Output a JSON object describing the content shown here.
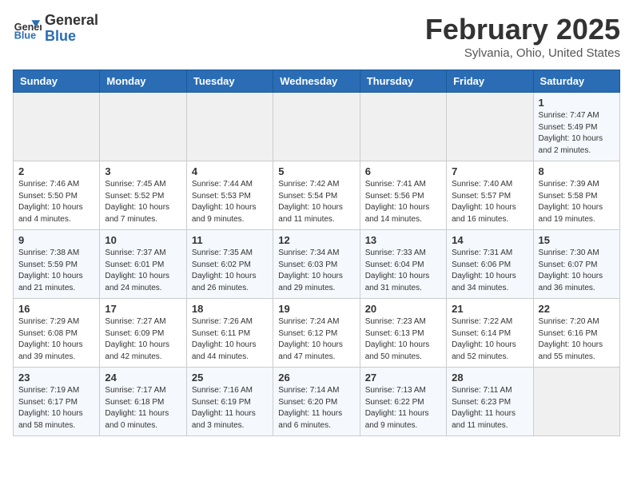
{
  "header": {
    "logo_general": "General",
    "logo_blue": "Blue",
    "title": "February 2025",
    "subtitle": "Sylvania, Ohio, United States"
  },
  "days_of_week": [
    "Sunday",
    "Monday",
    "Tuesday",
    "Wednesday",
    "Thursday",
    "Friday",
    "Saturday"
  ],
  "weeks": [
    [
      {
        "day": "",
        "info": ""
      },
      {
        "day": "",
        "info": ""
      },
      {
        "day": "",
        "info": ""
      },
      {
        "day": "",
        "info": ""
      },
      {
        "day": "",
        "info": ""
      },
      {
        "day": "",
        "info": ""
      },
      {
        "day": "1",
        "info": "Sunrise: 7:47 AM\nSunset: 5:49 PM\nDaylight: 10 hours and 2 minutes."
      }
    ],
    [
      {
        "day": "2",
        "info": "Sunrise: 7:46 AM\nSunset: 5:50 PM\nDaylight: 10 hours and 4 minutes."
      },
      {
        "day": "3",
        "info": "Sunrise: 7:45 AM\nSunset: 5:52 PM\nDaylight: 10 hours and 7 minutes."
      },
      {
        "day": "4",
        "info": "Sunrise: 7:44 AM\nSunset: 5:53 PM\nDaylight: 10 hours and 9 minutes."
      },
      {
        "day": "5",
        "info": "Sunrise: 7:42 AM\nSunset: 5:54 PM\nDaylight: 10 hours and 11 minutes."
      },
      {
        "day": "6",
        "info": "Sunrise: 7:41 AM\nSunset: 5:56 PM\nDaylight: 10 hours and 14 minutes."
      },
      {
        "day": "7",
        "info": "Sunrise: 7:40 AM\nSunset: 5:57 PM\nDaylight: 10 hours and 16 minutes."
      },
      {
        "day": "8",
        "info": "Sunrise: 7:39 AM\nSunset: 5:58 PM\nDaylight: 10 hours and 19 minutes."
      }
    ],
    [
      {
        "day": "9",
        "info": "Sunrise: 7:38 AM\nSunset: 5:59 PM\nDaylight: 10 hours and 21 minutes."
      },
      {
        "day": "10",
        "info": "Sunrise: 7:37 AM\nSunset: 6:01 PM\nDaylight: 10 hours and 24 minutes."
      },
      {
        "day": "11",
        "info": "Sunrise: 7:35 AM\nSunset: 6:02 PM\nDaylight: 10 hours and 26 minutes."
      },
      {
        "day": "12",
        "info": "Sunrise: 7:34 AM\nSunset: 6:03 PM\nDaylight: 10 hours and 29 minutes."
      },
      {
        "day": "13",
        "info": "Sunrise: 7:33 AM\nSunset: 6:04 PM\nDaylight: 10 hours and 31 minutes."
      },
      {
        "day": "14",
        "info": "Sunrise: 7:31 AM\nSunset: 6:06 PM\nDaylight: 10 hours and 34 minutes."
      },
      {
        "day": "15",
        "info": "Sunrise: 7:30 AM\nSunset: 6:07 PM\nDaylight: 10 hours and 36 minutes."
      }
    ],
    [
      {
        "day": "16",
        "info": "Sunrise: 7:29 AM\nSunset: 6:08 PM\nDaylight: 10 hours and 39 minutes."
      },
      {
        "day": "17",
        "info": "Sunrise: 7:27 AM\nSunset: 6:09 PM\nDaylight: 10 hours and 42 minutes."
      },
      {
        "day": "18",
        "info": "Sunrise: 7:26 AM\nSunset: 6:11 PM\nDaylight: 10 hours and 44 minutes."
      },
      {
        "day": "19",
        "info": "Sunrise: 7:24 AM\nSunset: 6:12 PM\nDaylight: 10 hours and 47 minutes."
      },
      {
        "day": "20",
        "info": "Sunrise: 7:23 AM\nSunset: 6:13 PM\nDaylight: 10 hours and 50 minutes."
      },
      {
        "day": "21",
        "info": "Sunrise: 7:22 AM\nSunset: 6:14 PM\nDaylight: 10 hours and 52 minutes."
      },
      {
        "day": "22",
        "info": "Sunrise: 7:20 AM\nSunset: 6:16 PM\nDaylight: 10 hours and 55 minutes."
      }
    ],
    [
      {
        "day": "23",
        "info": "Sunrise: 7:19 AM\nSunset: 6:17 PM\nDaylight: 10 hours and 58 minutes."
      },
      {
        "day": "24",
        "info": "Sunrise: 7:17 AM\nSunset: 6:18 PM\nDaylight: 11 hours and 0 minutes."
      },
      {
        "day": "25",
        "info": "Sunrise: 7:16 AM\nSunset: 6:19 PM\nDaylight: 11 hours and 3 minutes."
      },
      {
        "day": "26",
        "info": "Sunrise: 7:14 AM\nSunset: 6:20 PM\nDaylight: 11 hours and 6 minutes."
      },
      {
        "day": "27",
        "info": "Sunrise: 7:13 AM\nSunset: 6:22 PM\nDaylight: 11 hours and 9 minutes."
      },
      {
        "day": "28",
        "info": "Sunrise: 7:11 AM\nSunset: 6:23 PM\nDaylight: 11 hours and 11 minutes."
      },
      {
        "day": "",
        "info": ""
      }
    ]
  ]
}
